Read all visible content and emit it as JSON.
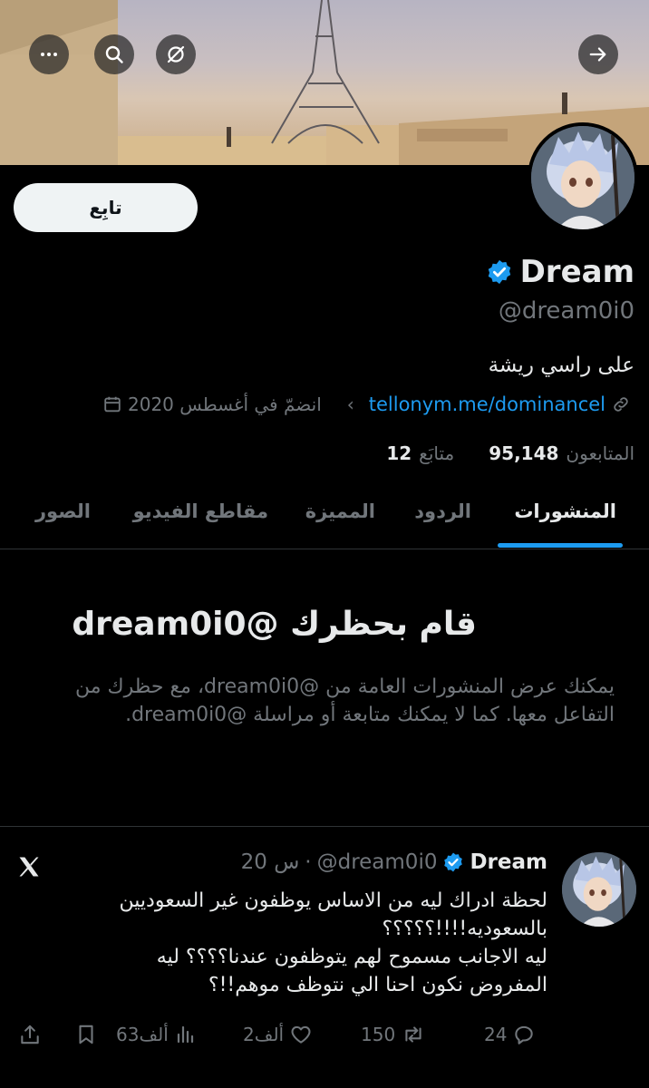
{
  "header": {
    "back_icon": "arrow-right-icon",
    "grok_icon": "grok-icon",
    "search_icon": "search-icon",
    "more_icon": "more-icon"
  },
  "profile": {
    "follow_label": "تابِع",
    "display_name": "Dream",
    "handle": "@dream0i0",
    "bio": "على راسي ريشة",
    "link": "tellonym.me/dominancel",
    "joined": "انضمّ في أغسطس 2020",
    "following_count": "12",
    "following_label": "متابَع",
    "followers_count": "95,148",
    "followers_label": "المتابعون"
  },
  "tabs": [
    "المنشورات",
    "الردود",
    "المميزة",
    "مقاطع الفيديو",
    "الصور"
  ],
  "blocked": {
    "title": "قام بحظرك @dream0i0",
    "description": "يمكنك عرض المنشورات العامة من @dream0i0، مع حظرك من التفاعل معها. كما لا يمكنك متابعة أو مراسلة @dream0i0."
  },
  "tweet": {
    "name": "Dream",
    "handle": "@dream0i0",
    "separator": "·",
    "time": "20 س",
    "lines": [
      "لحظة ادراك ليه من الاساس يوظفون غير السعوديين",
      "بالسعوديه!!!!؟؟؟؟؟",
      "ليه الاجانب مسموح لهم يتوظفون عندنا؟؟؟؟ ليه",
      "المفروض نكون احنا الي نتوظف موهم!!؟"
    ],
    "replies": "24",
    "reposts": "150",
    "likes": "2ألف",
    "views": "63ألف"
  },
  "colors": {
    "accent": "#1d9bf0",
    "background": "#000000",
    "text": "#e7e9ea",
    "muted": "#71767b"
  }
}
